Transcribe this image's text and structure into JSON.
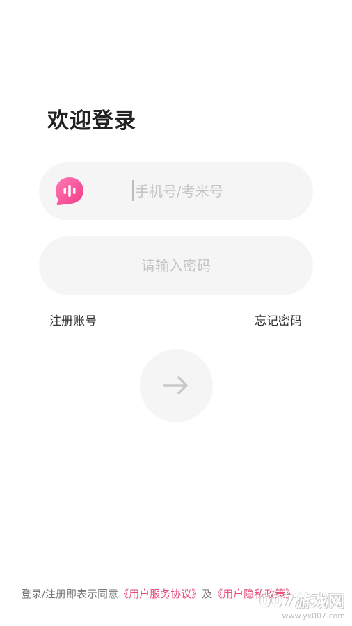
{
  "login": {
    "title": "欢迎登录",
    "phone_placeholder": "手机号/考米号",
    "phone_value": "",
    "password_placeholder": "请输入密码",
    "password_value": "",
    "register_label": "注册账号",
    "forgot_label": "忘记密码",
    "submit_icon": "arrow-right-icon",
    "logo_icon": "chat-bubble-logo-icon"
  },
  "agreement": {
    "prefix": "登录/注册即表示同意",
    "terms_label": "《用户服务协议》",
    "conjunction": "及",
    "privacy_label": "《用户隐私政策》"
  },
  "watermark": {
    "main": "007游戏网",
    "sub": "www.yx007.com"
  },
  "colors": {
    "background": "#ffffff",
    "field_background": "#f5f5f5",
    "accent_pink": "#e8507a",
    "logo_gradient_start": "#ff7ab6",
    "logo_gradient_end": "#f23a86",
    "arrow": "#c8c8c8"
  }
}
